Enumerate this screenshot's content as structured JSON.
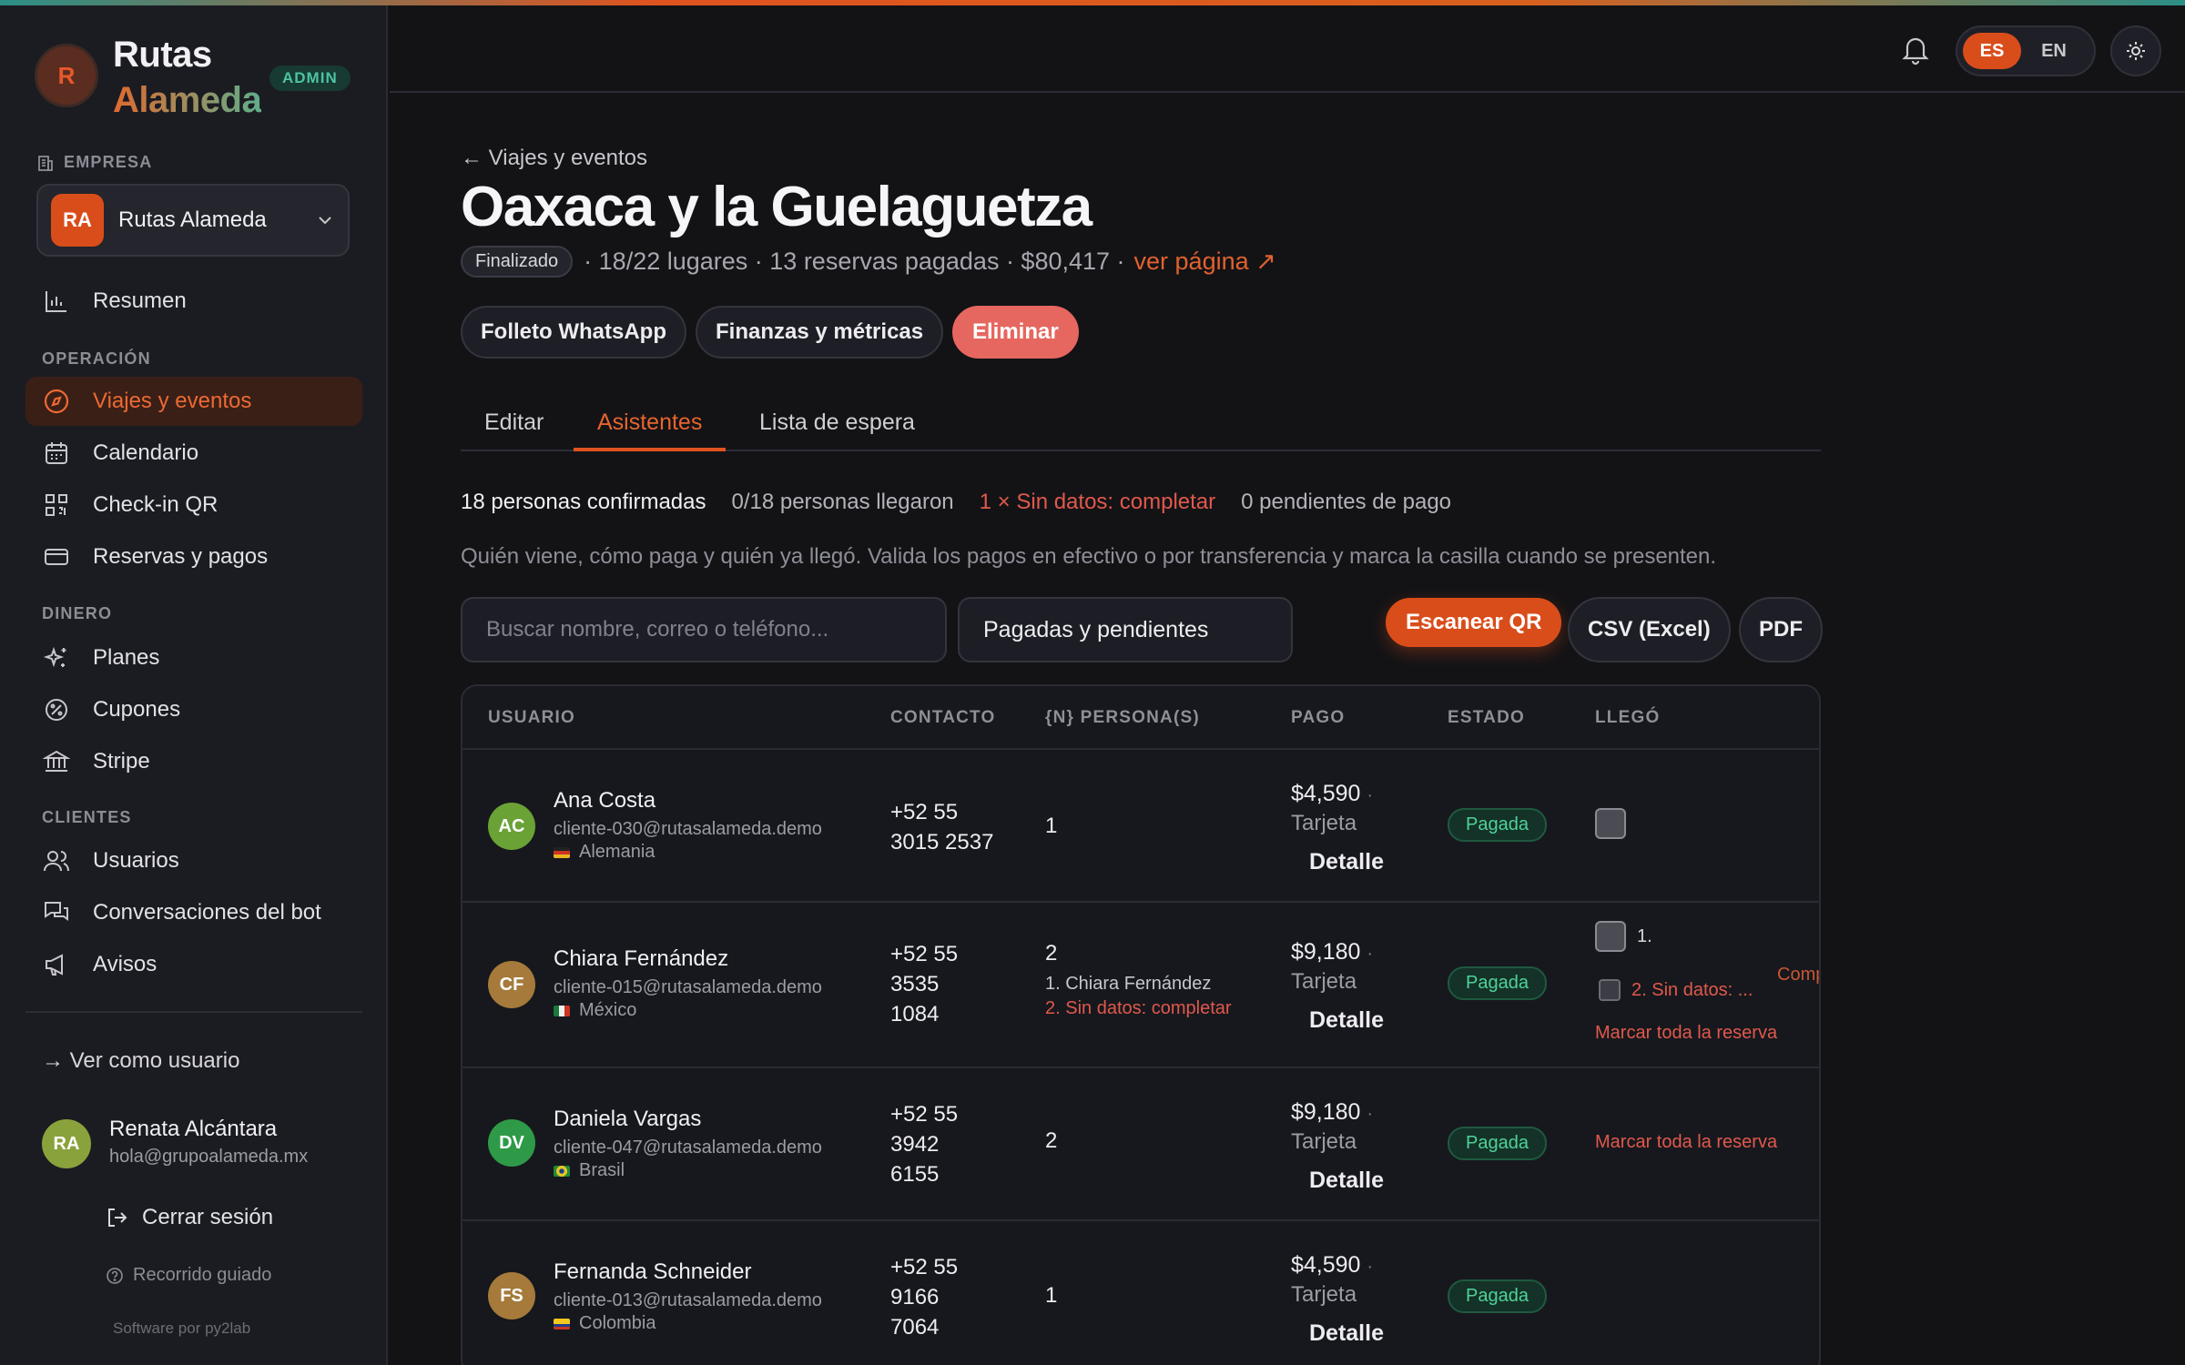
{
  "brand": {
    "logo_letter": "R",
    "name_line1": "Rutas",
    "name_line2": "Alameda",
    "badge": "ADMIN"
  },
  "sidebar": {
    "company_label": "EMPRESA",
    "company": {
      "initials": "RA",
      "name": "Rutas Alameda"
    },
    "summary": "Resumen",
    "sections": {
      "operacion": "OPERACIÓN",
      "dinero": "DINERO",
      "clientes": "CLIENTES"
    },
    "items": {
      "viajes": "Viajes y eventos",
      "calendario": "Calendario",
      "checkin": "Check-in QR",
      "reservas": "Reservas y pagos",
      "planes": "Planes",
      "cupones": "Cupones",
      "stripe": "Stripe",
      "usuarios": "Usuarios",
      "conversaciones": "Conversaciones del bot",
      "avisos": "Avisos"
    },
    "view_as_user": "→ Ver como usuario",
    "user": {
      "initials": "RA",
      "name": "Renata Alcántara",
      "email": "hola@grupoalameda.mx"
    },
    "logout": "Cerrar sesión",
    "tour": "Recorrido guiado",
    "credit": "Software por py2lab"
  },
  "header": {
    "lang_es": "ES",
    "lang_en": "EN"
  },
  "page": {
    "back": "← Viajes y eventos",
    "title": "Oaxaca y la Guelaguetza",
    "status": "Finalizado",
    "meta": "· 18/22 lugares · 13 reservas pagadas · $80,417 ·",
    "view_page": "ver página ↗",
    "actions": {
      "whatsapp": "Folleto WhatsApp",
      "finance": "Finanzas y métricas",
      "delete": "Eliminar"
    },
    "tabs": {
      "edit": "Editar",
      "attendees": "Asistentes",
      "waitlist": "Lista de espera"
    },
    "stats": {
      "confirmed": "18 personas confirmadas",
      "arrived": "0/18 personas llegaron",
      "missing": "1 × Sin datos: completar",
      "pending": "0 pendientes de pago"
    },
    "description": "Quién viene, cómo paga y quién ya llegó. Valida los pagos en efectivo o por transferencia y marca la casilla cuando se presenten.",
    "search_placeholder": "Buscar nombre, correo o teléfono...",
    "filter_value": "Pagadas y pendientes",
    "tools": {
      "scan": "Escanear QR",
      "csv": "CSV (Excel)",
      "pdf": "PDF"
    }
  },
  "table": {
    "headers": {
      "user": "USUARIO",
      "contact": "CONTACTO",
      "persons": "{N} PERSONA(S)",
      "payment": "PAGO",
      "status": "ESTADO",
      "arrived": "LLEGÓ"
    },
    "paid_label": "Pagada",
    "detail_label": "Detalle",
    "method_label": "Tarjeta",
    "mark_all": "Marcar toda la reserva",
    "rows": [
      {
        "initials": "AC",
        "name": "Ana Costa",
        "email": "cliente-030@rutasalameda.demo",
        "country": "Alemania",
        "phone1": "+52 55",
        "phone2": "3015 2537",
        "persons": "1",
        "amount": "$4,590"
      },
      {
        "initials": "CF",
        "name": "Chiara Fernández",
        "email": "cliente-015@rutasalameda.demo",
        "country": "México",
        "phone1": "+52 55",
        "phone2": "3535",
        "phone3": "1084",
        "persons": "2",
        "sub1": "1. Chiara Fernández",
        "sub2": "2. Sin datos: completar",
        "amount": "$9,180",
        "arrive1": "1.",
        "arrive2": "2. Sin datos: ...",
        "comp": "Comp"
      },
      {
        "initials": "DV",
        "name": "Daniela Vargas",
        "email": "cliente-047@rutasalameda.demo",
        "country": "Brasil",
        "phone1": "+52 55",
        "phone2": "3942",
        "phone3": "6155",
        "persons": "2",
        "amount": "$9,180"
      },
      {
        "initials": "FS",
        "name": "Fernanda Schneider",
        "email": "cliente-013@rutasalameda.demo",
        "country": "Colombia",
        "phone1": "+52 55",
        "phone2": "9166",
        "phone3": "7064",
        "persons": "1",
        "amount": "$4,590"
      }
    ]
  },
  "colors": {
    "accent": "#d94d1a",
    "success": "#4fd29a",
    "danger": "#e6675f"
  }
}
